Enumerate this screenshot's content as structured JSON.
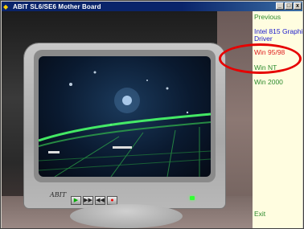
{
  "window": {
    "title": "ABIT SL6/SE6 Mother Board",
    "icon": "app-icon"
  },
  "title_buttons": {
    "minimize": "_",
    "maximize": "□",
    "close": "x"
  },
  "menu": {
    "previous": "Previous",
    "intel_driver_line1": "Intel 815 Graphic",
    "intel_driver_line2": "Driver",
    "win9598": "Win 95/98",
    "winnt": "Win NT",
    "win2000": "Win 2000",
    "exit": "Exit"
  },
  "monitor": {
    "brand": "ABIT"
  },
  "controls": [
    "play-icon",
    "fast-forward-icon",
    "rewind-icon",
    "record-icon"
  ],
  "colors": {
    "menu_green": "#2e8b2e",
    "menu_blue": "#1a1acc",
    "menu_red": "#e02020",
    "annotation_red": "#e60000"
  }
}
